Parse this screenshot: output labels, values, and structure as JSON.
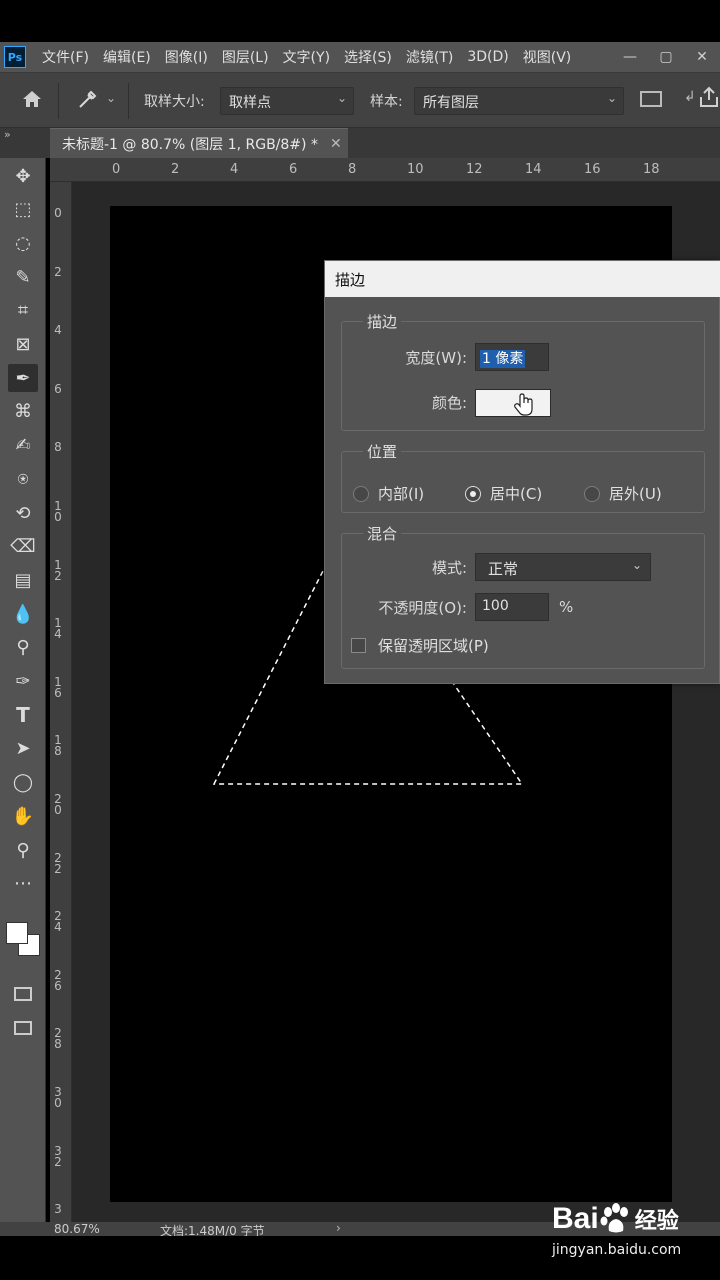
{
  "app": {
    "logo": "Ps"
  },
  "menu": [
    "文件(F)",
    "编辑(E)",
    "图像(I)",
    "图层(L)",
    "文字(Y)",
    "选择(S)",
    "滤镜(T)",
    "3D(D)",
    "视图(V)"
  ],
  "window_controls": {
    "minimize": "—",
    "restore": "▢",
    "close": "✕"
  },
  "options_bar": {
    "sample_size_label": "取样大小:",
    "sample_size_value": "取样点",
    "sample_label": "样本:",
    "sample_value": "所有图层"
  },
  "document_tab": {
    "title": "未标题-1 @ 80.7% (图层 1, RGB/8#) *",
    "close": "✕"
  },
  "ruler": {
    "horizontal": [
      "0",
      "2",
      "4",
      "6",
      "8",
      "10",
      "12",
      "14",
      "16",
      "18"
    ],
    "vertical": [
      "0",
      "2",
      "4",
      "6",
      "8",
      "10",
      "12",
      "14",
      "16",
      "18",
      "20",
      "22",
      "24",
      "26",
      "28",
      "30",
      "32",
      "3"
    ]
  },
  "tools": [
    "move-icon",
    "marquee-icon",
    "lasso-icon",
    "quick-select-icon",
    "crop-icon",
    "frame-icon",
    "eyedropper-icon",
    "spot-heal-icon",
    "brush-icon",
    "stamp-icon",
    "history-brush-icon",
    "eraser-icon",
    "gradient-icon",
    "blur-icon",
    "dodge-icon",
    "pen-icon",
    "type-icon",
    "path-select-icon",
    "ellipse-icon",
    "hand-icon",
    "zoom-icon",
    "more-icon"
  ],
  "dialog": {
    "title": "描边",
    "stroke_group": "描边",
    "width_label": "宽度(W):",
    "width_value": "1 像素",
    "color_label": "颜色:",
    "location_group": "位置",
    "location_options": [
      "内部(I)",
      "居中(C)",
      "居外(U)"
    ],
    "location_selected": "居中(C)",
    "blending_group": "混合",
    "mode_label": "模式:",
    "mode_value": "正常",
    "opacity_label": "不透明度(O):",
    "opacity_value": "100",
    "opacity_unit": "%",
    "preserve_label": "保留透明区域(P)",
    "preserve_checked": false
  },
  "status": {
    "zoom": "80.67%",
    "doc_info": "文档:1.48M/0 字节"
  },
  "watermark": {
    "brand": "Bai",
    "brand_suffix": "经验",
    "url": "jingyan.baidu.com"
  },
  "colors": {
    "foreground": "#ffffff",
    "swatch": "#f2f2f2",
    "selection_accent": "#1f5fae"
  }
}
